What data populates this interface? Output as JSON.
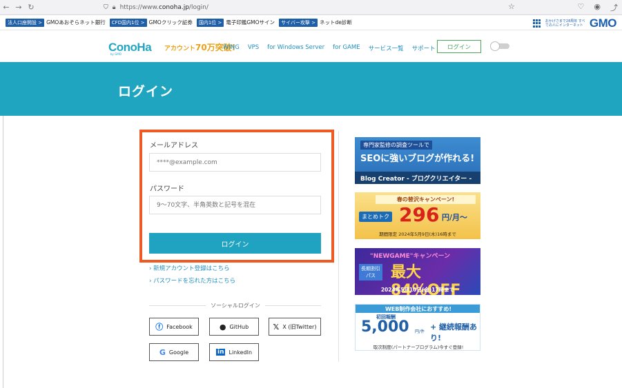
{
  "browser": {
    "url_prefix": "https://www.",
    "url_domain": "conoha.jp",
    "url_path": "/login/"
  },
  "gmo_bar": {
    "items": [
      {
        "tag": "法人口座開設 >",
        "text": "GMOあおぞらネット銀行"
      },
      {
        "tag": "CFD国内1位 >",
        "text": "GMOクリック証券"
      },
      {
        "tag": "国内1位 >",
        "text": "電子印鑑GMOサイン"
      },
      {
        "tag": "サイバー攻撃 >",
        "text": "ネットde診断"
      }
    ],
    "right_small": "おかげさまで28周年 すべての人にインターネット",
    "right_logo": "GMO"
  },
  "header": {
    "logo": "ConoHa",
    "logo_sub": "by GMO",
    "promo": "70万突破!",
    "promo_small": "アカウント",
    "nav": [
      "WING",
      "VPS",
      "for Windows Server",
      "for GAME",
      "サービス一覧",
      "サポート"
    ],
    "login_button": "ログイン"
  },
  "hero": {
    "title": "ログイン"
  },
  "form": {
    "email_label": "メールアドレス",
    "email_placeholder": "****@example.com",
    "password_label": "パスワード",
    "password_placeholder": "9〜70文字、半角英数と記号を混在",
    "submit": "ログイン",
    "link_new": "新規アカウント登録はこちら",
    "link_forgot": "パスワードを忘れた方はこちら"
  },
  "social": {
    "label": "ソーシャルログイン",
    "facebook": "Facebook",
    "github": "GitHub",
    "x": "X (旧Twitter)",
    "google": "Google",
    "linkedin": "LinkedIn"
  },
  "banners": {
    "b1": {
      "t1": "専門家監修の調査ツールで",
      "t2": "SEOに強いブログが作れる!",
      "t3": "Blog Creator - ブログクリエイター -"
    },
    "b2": {
      "top": "春の替沢キャンペーン!",
      "tag": "まとめトク",
      "price": "296",
      "unit": "円/月〜",
      "foot": "期間限定 2024年5月9日(木)16時まで"
    },
    "b3": {
      "top": "\"NEWGAME\"キャンペーン",
      "tag": "長期割引パス",
      "big": "最大84%OFF",
      "foot": "2024年5月10日(金)17時まで"
    },
    "b4": {
      "top": "WEB制作会社におすすめ!",
      "sub": "初回報酬",
      "num": "5,000",
      "unit": "円/件",
      "r": "+ 継続報酬あり!",
      "foot": "取次制度(パートナープログラム)今すぐ登録!"
    }
  }
}
